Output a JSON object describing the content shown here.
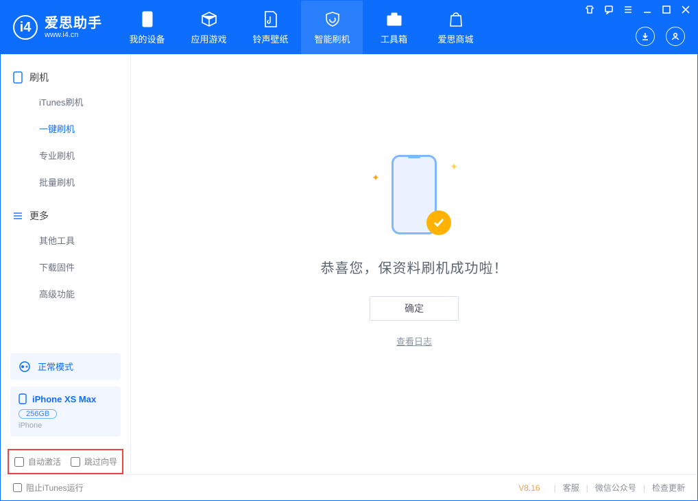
{
  "app": {
    "name": "爱思助手",
    "url": "www.i4.cn"
  },
  "nav": {
    "items": [
      {
        "label": "我的设备"
      },
      {
        "label": "应用游戏"
      },
      {
        "label": "铃声壁纸"
      },
      {
        "label": "智能刷机"
      },
      {
        "label": "工具箱"
      },
      {
        "label": "爱思商城"
      }
    ]
  },
  "sidebar": {
    "group_flash": "刷机",
    "flash_items": [
      {
        "label": "iTunes刷机"
      },
      {
        "label": "一键刷机"
      },
      {
        "label": "专业刷机"
      },
      {
        "label": "批量刷机"
      }
    ],
    "group_more": "更多",
    "more_items": [
      {
        "label": "其他工具"
      },
      {
        "label": "下载固件"
      },
      {
        "label": "高级功能"
      }
    ],
    "mode": "正常模式",
    "device": {
      "name": "iPhone XS Max",
      "capacity": "256GB",
      "type": "iPhone"
    },
    "opts": {
      "auto_activate": "自动激活",
      "skip_guide": "跳过向导"
    }
  },
  "main": {
    "success_msg": "恭喜您，保资料刷机成功啦！",
    "ok_btn": "确定",
    "view_log": "查看日志"
  },
  "footer": {
    "block_itunes": "阻止iTunes运行",
    "version": "V8.16",
    "links": {
      "support": "客服",
      "wechat": "微信公众号",
      "update": "检查更新"
    }
  }
}
